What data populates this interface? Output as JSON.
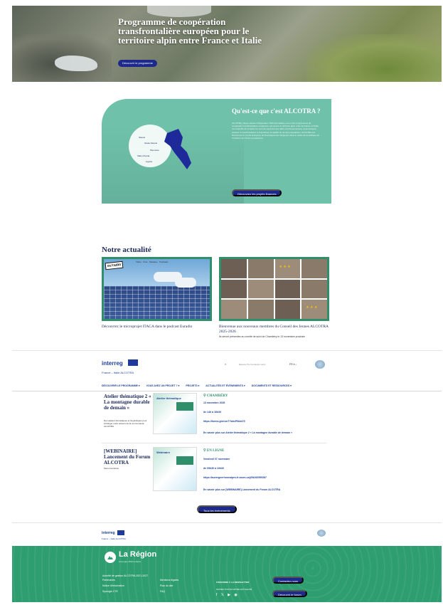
{
  "hero": {
    "title": "Programme de coopération transfrontalière européen pour le territoire alpin entre France et Italie",
    "button_label": "Découvrir le programme"
  },
  "alcotra": {
    "title": "Qu'est-ce que c'est ALCOTRA ?",
    "text": "ALCOTRA, Alpes Latines COopération TRAnsfrontalière est un des programmes de coopération transfrontalière européens, qui couvre le territoire alpin entre la France et l'Italie. Les objectifs du programme sont de répondre aux défis environnementaux, économiques, sociaux et transfrontaliers et d'améliorer la qualité de vie des populations. ALCOTRA est financé par le Fonds Européen de Développement Régional, dans le cadre de la politique de Cohésion de l'Union européenne.",
    "button_label": "Découvrez les projets financés",
    "map_labels": [
      "Savoie",
      "Haute-Savoie",
      "Piemonte",
      "Valle d'Aosta",
      "Liguria"
    ]
  },
  "news": {
    "title": "Notre actualité",
    "cards": [
      {
        "badge": "eu'radio",
        "topbar": "Vidéo · Ciné · Musique · Podcasts",
        "caption": "Découvrez le microprojet ITACA dans le podcast Euradio",
        "sub": ""
      },
      {
        "badge": "",
        "topbar": "",
        "caption": "Bienvenue aux nouveaux membres du Conseil des Jeunes ALCOTRA 2025-2026",
        "sub": "Ils seront présentés au comité de suivi de Chambéry le 13 novembre prochain"
      }
    ]
  },
  "interreg": {
    "logo": "interreg",
    "subtitle": "France – Italie ALCOTRA",
    "search_icon": "search-icon",
    "links": "Espace Pro   Contactez-nous",
    "lang": "FR ▾  ⌕",
    "nav": [
      "DÉCOUVRIR LE PROGRAMME ▾",
      "VOUS AVEZ UN PROJET ? ▾",
      "PROJETS ▾",
      "ACTUALITÉS ET ÉVÉNEMENTS ▾",
      "DOCUMENTS ET RESSOURCES ▾"
    ]
  },
  "events": [
    {
      "title": "Atelier thématique 2 « La montagne durable de demain »",
      "desc": "Des ateliers thématiques et linguistiques pour échanger entre acteurs de la communauté ALCOTRA",
      "img_head": "Atelier thématique",
      "location": "CHAMBÉRY",
      "date": "13 novembre 2025",
      "time": "de 14h à 16h30",
      "link": "https://forms.gle/rorrTYahcPfkbb79",
      "more": "En savoir plus sur Atelier thématique 2 « La montagne durable de demain »"
    },
    {
      "title": "[WEBINAIRE] Lancement du Forum ALCOTRA",
      "desc": "Sans inscription",
      "img_head": "Webinaire",
      "location": "EN LIGNE",
      "date": "Vendredi 07 novembre",
      "time": "de 09h30 à 10h30",
      "link": "https://auvergnerhonealpes-fr.zoom.us/j/94262959387",
      "more": "En savoir plus sur [WEBINAIRE] Lancement du Forum ALCOTRA"
    }
  ],
  "all_events_label": "Tous les événements",
  "interreg_footer": {
    "logo": "interreg",
    "subtitle": "France – Italie ALCOTRA"
  },
  "region": {
    "name": "La Région",
    "sub": "Auvergne-Rhône-Alpes",
    "authority": "Autorité de gestion ALCOTRA 2021-2027",
    "col1": [
      "Partenaires",
      "Notice d'information",
      "Synergie CTE"
    ],
    "col2": [
      "Mentions légales",
      "Plan du site",
      "FAQ"
    ],
    "newsletter": "S'INSCRIRE À LA NEWSLETTER",
    "follow": "SUIVEZ TOUTE NOTRE ACTUALITÉ",
    "social": "f  𝕏  ▶  ◉",
    "contact_btn": "Contactez-nous",
    "forum_btn": "Découvrir le forum"
  }
}
